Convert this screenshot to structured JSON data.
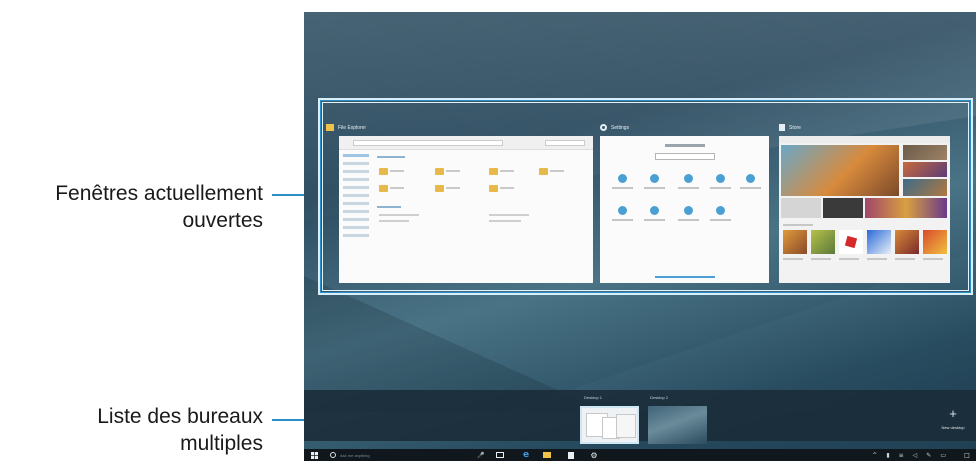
{
  "callouts": {
    "open_windows": {
      "line1": "Fenêtres actuellement",
      "line2": "ouvertes"
    },
    "desktops_list": {
      "line1": "Liste des bureaux",
      "line2": "multiples"
    }
  },
  "windows": [
    {
      "title": "File Explorer",
      "icon": "folder-icon"
    },
    {
      "title": "Settings",
      "icon": "gear-icon"
    },
    {
      "title": "Store",
      "icon": "store-bag-icon"
    }
  ],
  "desktops": [
    {
      "label": "Desktop 1",
      "active": true
    },
    {
      "label": "Desktop 2",
      "active": false
    }
  ],
  "new_desktop": {
    "symbol": "+",
    "label": "New desktop"
  },
  "taskbar": {
    "start_icon": "windows-logo-icon",
    "search_placeholder": "Ask me anything",
    "pinned": [
      "mic-icon",
      "task-view-icon",
      "edge-icon",
      "file-explorer-icon",
      "store-icon",
      "settings-gear-icon"
    ],
    "tray": [
      "chevron-up-icon",
      "battery-icon",
      "network-icon",
      "volume-icon",
      "pen-icon",
      "keyboard-icon",
      "notification-icon"
    ]
  },
  "colors": {
    "accent": "#2a8fc6",
    "frame": "#d9eef8",
    "taskbar": "#10171d"
  }
}
